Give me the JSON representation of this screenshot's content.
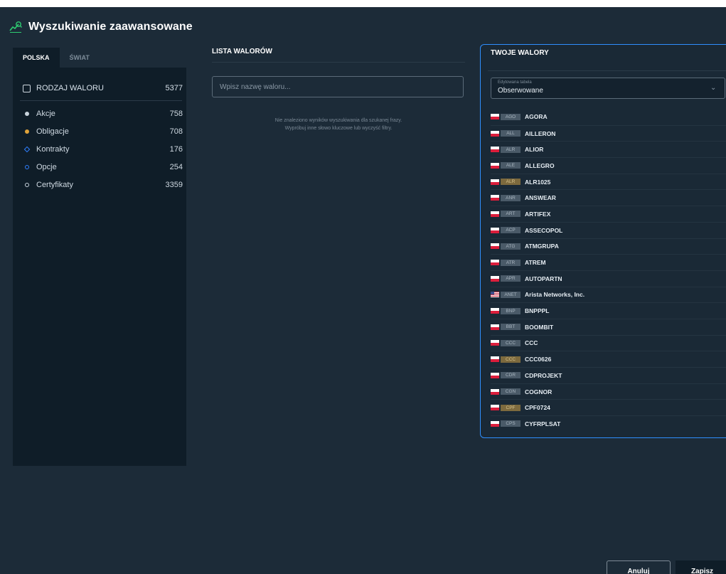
{
  "header": {
    "title": "Wyszukiwanie zaawansowane",
    "icon": "chart-search-icon"
  },
  "left_panel": {
    "tabs": [
      {
        "label": "POLSKA",
        "active": true
      },
      {
        "label": "ŚWIAT",
        "active": false
      }
    ],
    "category_header": {
      "label": "RODZAJ WALORU",
      "count": "5377"
    },
    "categories": [
      {
        "label": "Akcje",
        "count": "758",
        "color": "#c9d3dc"
      },
      {
        "label": "Obligacje",
        "count": "708",
        "color": "#e0a33a"
      },
      {
        "label": "Kontrakty",
        "count": "176",
        "color": "#2f80ff"
      },
      {
        "label": "Opcje",
        "count": "254",
        "color": "#2f80ff"
      },
      {
        "label": "Certyfikaty",
        "count": "3359",
        "color": "#c9d3dc"
      }
    ]
  },
  "middle_panel": {
    "title": "LISTA WALORÓW",
    "search_placeholder": "Wpisz nazwę waloru...",
    "empty_line1": "Nie znaleziono wyników wyszukiwania dla szukanej frazy.",
    "empty_line2": "Wypróbuj inne słowo kluczowe lub wyczyść filtry."
  },
  "right_panel": {
    "title": "TWOJE WALORY",
    "table_caption": "Edytowana tabela",
    "table_value": "Obserwowane",
    "items": [
      {
        "ticker": "AGO",
        "name": "AGORA",
        "flag": "pl",
        "warn": false
      },
      {
        "ticker": "ALL",
        "name": "AILLERON",
        "flag": "pl",
        "warn": false
      },
      {
        "ticker": "ALR",
        "name": "ALIOR",
        "flag": "pl",
        "warn": false
      },
      {
        "ticker": "ALE",
        "name": "ALLEGRO",
        "flag": "pl",
        "warn": false
      },
      {
        "ticker": "ALR",
        "name": "ALR1025",
        "flag": "pl",
        "warn": true
      },
      {
        "ticker": "ANR",
        "name": "ANSWEAR",
        "flag": "pl",
        "warn": false
      },
      {
        "ticker": "ART",
        "name": "ARTIFEX",
        "flag": "pl",
        "warn": false
      },
      {
        "ticker": "ACP",
        "name": "ASSECOPOL",
        "flag": "pl",
        "warn": false
      },
      {
        "ticker": "ATG",
        "name": "ATMGRUPA",
        "flag": "pl",
        "warn": false
      },
      {
        "ticker": "ATR",
        "name": "ATREM",
        "flag": "pl",
        "warn": false
      },
      {
        "ticker": "APR",
        "name": "AUTOPARTN",
        "flag": "pl",
        "warn": false
      },
      {
        "ticker": "ANET",
        "name": "Arista Networks, Inc.",
        "flag": "us",
        "warn": false
      },
      {
        "ticker": "BNP",
        "name": "BNPPPL",
        "flag": "pl",
        "warn": false
      },
      {
        "ticker": "BBT",
        "name": "BOOMBIT",
        "flag": "pl",
        "warn": false
      },
      {
        "ticker": "CCC",
        "name": "CCC",
        "flag": "pl",
        "warn": false
      },
      {
        "ticker": "CCC",
        "name": "CCC0626",
        "flag": "pl",
        "warn": true
      },
      {
        "ticker": "CDR",
        "name": "CDPROJEKT",
        "flag": "pl",
        "warn": false
      },
      {
        "ticker": "CGN",
        "name": "COGNOR",
        "flag": "pl",
        "warn": false
      },
      {
        "ticker": "CPF",
        "name": "CPF0724",
        "flag": "pl",
        "warn": true
      },
      {
        "ticker": "CPS",
        "name": "CYFRPLSAT",
        "flag": "pl",
        "warn": false
      }
    ]
  },
  "footer": {
    "cancel_label": "Anuluj",
    "save_label": "Zapisz"
  }
}
